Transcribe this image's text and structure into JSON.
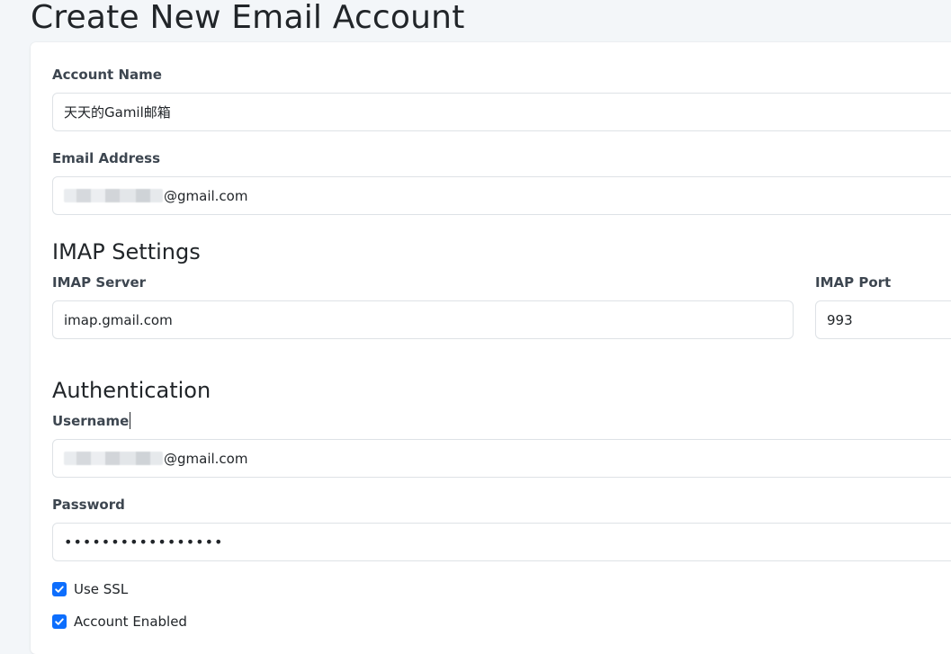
{
  "page": {
    "title": "Create New Email Account"
  },
  "form": {
    "account_name": {
      "label": "Account Name",
      "value": "天天的Gamil邮箱"
    },
    "email_address": {
      "label": "Email Address",
      "value_suffix": "@gmail.com"
    },
    "imap_settings": {
      "heading": "IMAP Settings",
      "server": {
        "label": "IMAP Server",
        "value": "imap.gmail.com"
      },
      "port": {
        "label": "IMAP Port",
        "value": "993"
      }
    },
    "authentication": {
      "heading": "Authentication",
      "username": {
        "label": "Username",
        "value_suffix": "@gmail.com"
      },
      "password": {
        "label": "Password",
        "value": "•••••••••••••••••"
      }
    },
    "use_ssl": {
      "label": "Use SSL",
      "checked": true
    },
    "account_enabled": {
      "label": "Account Enabled",
      "checked": true
    }
  },
  "colors": {
    "accent": "#0d6efd",
    "page_background": "#f3f6f9",
    "card_background": "#ffffff",
    "border": "#dee2e6"
  }
}
